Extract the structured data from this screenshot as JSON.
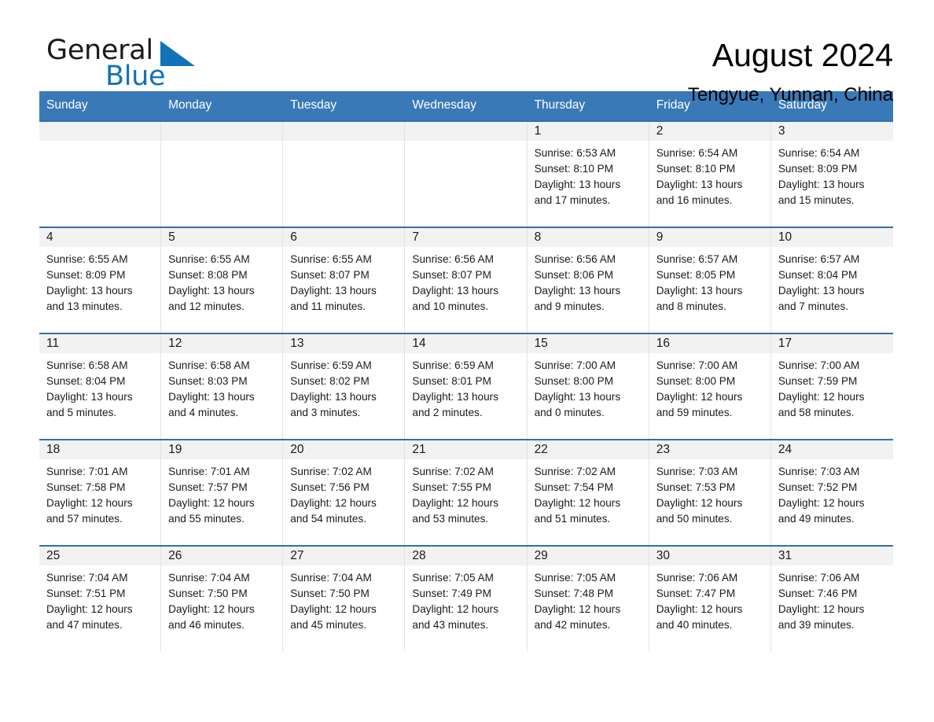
{
  "brand": {
    "word_general": "General",
    "word_blue": "Blue",
    "logo_icon": "triangle-logo-icon"
  },
  "header": {
    "title": "August 2024",
    "subtitle": "Tengyue, Yunnan, China"
  },
  "colors": {
    "header_blue": "#3a79b8",
    "row_rule_blue": "#2f72ae",
    "daynum_band": "#f2f2f2",
    "brand_blue": "#1272b8"
  },
  "weekdays": [
    "Sunday",
    "Monday",
    "Tuesday",
    "Wednesday",
    "Thursday",
    "Friday",
    "Saturday"
  ],
  "weeks": [
    [
      {
        "day": "",
        "sunrise": "",
        "sunset": "",
        "daylight": "",
        "empty": true
      },
      {
        "day": "",
        "sunrise": "",
        "sunset": "",
        "daylight": "",
        "empty": true
      },
      {
        "day": "",
        "sunrise": "",
        "sunset": "",
        "daylight": "",
        "empty": true
      },
      {
        "day": "",
        "sunrise": "",
        "sunset": "",
        "daylight": "",
        "empty": true
      },
      {
        "day": "1",
        "sunrise": "Sunrise: 6:53 AM",
        "sunset": "Sunset: 8:10 PM",
        "daylight": "Daylight: 13 hours\nand 17 minutes."
      },
      {
        "day": "2",
        "sunrise": "Sunrise: 6:54 AM",
        "sunset": "Sunset: 8:10 PM",
        "daylight": "Daylight: 13 hours\nand 16 minutes."
      },
      {
        "day": "3",
        "sunrise": "Sunrise: 6:54 AM",
        "sunset": "Sunset: 8:09 PM",
        "daylight": "Daylight: 13 hours\nand 15 minutes."
      }
    ],
    [
      {
        "day": "4",
        "sunrise": "Sunrise: 6:55 AM",
        "sunset": "Sunset: 8:09 PM",
        "daylight": "Daylight: 13 hours\nand 13 minutes."
      },
      {
        "day": "5",
        "sunrise": "Sunrise: 6:55 AM",
        "sunset": "Sunset: 8:08 PM",
        "daylight": "Daylight: 13 hours\nand 12 minutes."
      },
      {
        "day": "6",
        "sunrise": "Sunrise: 6:55 AM",
        "sunset": "Sunset: 8:07 PM",
        "daylight": "Daylight: 13 hours\nand 11 minutes."
      },
      {
        "day": "7",
        "sunrise": "Sunrise: 6:56 AM",
        "sunset": "Sunset: 8:07 PM",
        "daylight": "Daylight: 13 hours\nand 10 minutes."
      },
      {
        "day": "8",
        "sunrise": "Sunrise: 6:56 AM",
        "sunset": "Sunset: 8:06 PM",
        "daylight": "Daylight: 13 hours\nand 9 minutes."
      },
      {
        "day": "9",
        "sunrise": "Sunrise: 6:57 AM",
        "sunset": "Sunset: 8:05 PM",
        "daylight": "Daylight: 13 hours\nand 8 minutes."
      },
      {
        "day": "10",
        "sunrise": "Sunrise: 6:57 AM",
        "sunset": "Sunset: 8:04 PM",
        "daylight": "Daylight: 13 hours\nand 7 minutes."
      }
    ],
    [
      {
        "day": "11",
        "sunrise": "Sunrise: 6:58 AM",
        "sunset": "Sunset: 8:04 PM",
        "daylight": "Daylight: 13 hours\nand 5 minutes."
      },
      {
        "day": "12",
        "sunrise": "Sunrise: 6:58 AM",
        "sunset": "Sunset: 8:03 PM",
        "daylight": "Daylight: 13 hours\nand 4 minutes."
      },
      {
        "day": "13",
        "sunrise": "Sunrise: 6:59 AM",
        "sunset": "Sunset: 8:02 PM",
        "daylight": "Daylight: 13 hours\nand 3 minutes."
      },
      {
        "day": "14",
        "sunrise": "Sunrise: 6:59 AM",
        "sunset": "Sunset: 8:01 PM",
        "daylight": "Daylight: 13 hours\nand 2 minutes."
      },
      {
        "day": "15",
        "sunrise": "Sunrise: 7:00 AM",
        "sunset": "Sunset: 8:00 PM",
        "daylight": "Daylight: 13 hours\nand 0 minutes."
      },
      {
        "day": "16",
        "sunrise": "Sunrise: 7:00 AM",
        "sunset": "Sunset: 8:00 PM",
        "daylight": "Daylight: 12 hours\nand 59 minutes."
      },
      {
        "day": "17",
        "sunrise": "Sunrise: 7:00 AM",
        "sunset": "Sunset: 7:59 PM",
        "daylight": "Daylight: 12 hours\nand 58 minutes."
      }
    ],
    [
      {
        "day": "18",
        "sunrise": "Sunrise: 7:01 AM",
        "sunset": "Sunset: 7:58 PM",
        "daylight": "Daylight: 12 hours\nand 57 minutes."
      },
      {
        "day": "19",
        "sunrise": "Sunrise: 7:01 AM",
        "sunset": "Sunset: 7:57 PM",
        "daylight": "Daylight: 12 hours\nand 55 minutes."
      },
      {
        "day": "20",
        "sunrise": "Sunrise: 7:02 AM",
        "sunset": "Sunset: 7:56 PM",
        "daylight": "Daylight: 12 hours\nand 54 minutes."
      },
      {
        "day": "21",
        "sunrise": "Sunrise: 7:02 AM",
        "sunset": "Sunset: 7:55 PM",
        "daylight": "Daylight: 12 hours\nand 53 minutes."
      },
      {
        "day": "22",
        "sunrise": "Sunrise: 7:02 AM",
        "sunset": "Sunset: 7:54 PM",
        "daylight": "Daylight: 12 hours\nand 51 minutes."
      },
      {
        "day": "23",
        "sunrise": "Sunrise: 7:03 AM",
        "sunset": "Sunset: 7:53 PM",
        "daylight": "Daylight: 12 hours\nand 50 minutes."
      },
      {
        "day": "24",
        "sunrise": "Sunrise: 7:03 AM",
        "sunset": "Sunset: 7:52 PM",
        "daylight": "Daylight: 12 hours\nand 49 minutes."
      }
    ],
    [
      {
        "day": "25",
        "sunrise": "Sunrise: 7:04 AM",
        "sunset": "Sunset: 7:51 PM",
        "daylight": "Daylight: 12 hours\nand 47 minutes."
      },
      {
        "day": "26",
        "sunrise": "Sunrise: 7:04 AM",
        "sunset": "Sunset: 7:50 PM",
        "daylight": "Daylight: 12 hours\nand 46 minutes."
      },
      {
        "day": "27",
        "sunrise": "Sunrise: 7:04 AM",
        "sunset": "Sunset: 7:50 PM",
        "daylight": "Daylight: 12 hours\nand 45 minutes."
      },
      {
        "day": "28",
        "sunrise": "Sunrise: 7:05 AM",
        "sunset": "Sunset: 7:49 PM",
        "daylight": "Daylight: 12 hours\nand 43 minutes."
      },
      {
        "day": "29",
        "sunrise": "Sunrise: 7:05 AM",
        "sunset": "Sunset: 7:48 PM",
        "daylight": "Daylight: 12 hours\nand 42 minutes."
      },
      {
        "day": "30",
        "sunrise": "Sunrise: 7:06 AM",
        "sunset": "Sunset: 7:47 PM",
        "daylight": "Daylight: 12 hours\nand 40 minutes."
      },
      {
        "day": "31",
        "sunrise": "Sunrise: 7:06 AM",
        "sunset": "Sunset: 7:46 PM",
        "daylight": "Daylight: 12 hours\nand 39 minutes."
      }
    ]
  ]
}
